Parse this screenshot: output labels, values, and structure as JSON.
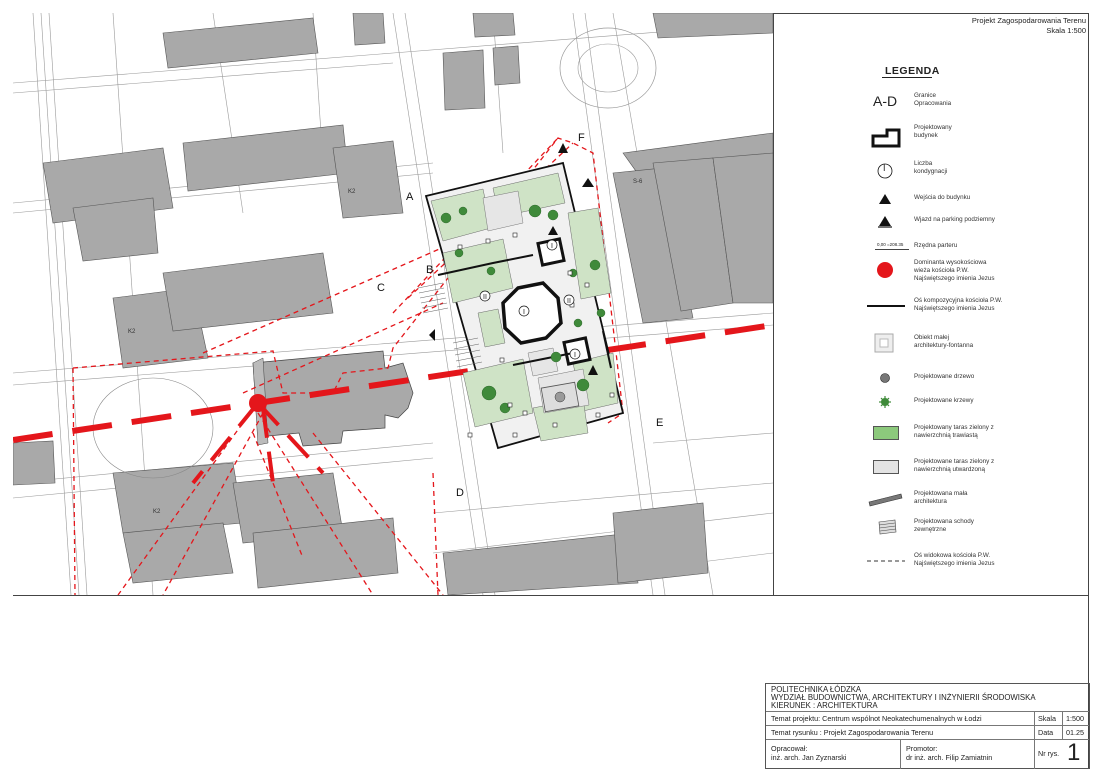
{
  "header": {
    "title": "Projekt Zagospodarowania Terenu",
    "scale": "Skala 1:500"
  },
  "legend": {
    "title": "LEGENDA",
    "items": [
      {
        "symbol": "A-D",
        "text": "Granice\nOpracowania"
      },
      {
        "text": "Projektowany\nbudynek"
      },
      {
        "symbol": "I",
        "text": "Liczba\nkondygnacji"
      },
      {
        "text": "Wejścia do budynku"
      },
      {
        "text": "Wjazd na parking podziemny"
      },
      {
        "symbol": "0,00 =208.35",
        "text": "Rzędna parteru"
      },
      {
        "text": "Dominanta wysokościowa\nwieża kościoła P.W.\nNajświętszego imienia Jezus"
      },
      {
        "text": "Oś kompozycyjna kościoła P.W.\nNajświętszego imienia Jezus"
      },
      {
        "text": "Obiekt małej\narchitektury-fontanna"
      },
      {
        "text": "Projektowane drzewo"
      },
      {
        "text": "Projektowane krzewy"
      },
      {
        "text": "Projektowany taras zielony z\nnawierzchnią trawiastą"
      },
      {
        "text": "Projektowane taras zielony z\nnawierzchnią utwardzoną"
      },
      {
        "text": "Projektowana mała\narchitektura"
      },
      {
        "text": "Projektowana schody\nzewnętrzne"
      },
      {
        "text": "Oś widokowa kościoła P.W.\nNajświętszego imienia Jezus"
      }
    ]
  },
  "map_labels": {
    "A": "A",
    "B": "B",
    "C": "C",
    "D": "D",
    "E": "E",
    "F": "F",
    "level_1a": "I",
    "level_1b": "I",
    "level_1c": "I",
    "level_2a": "II",
    "level_2b": "II",
    "s6": "S-6",
    "k2a": "K2",
    "k2b": "K2",
    "k2c": "K2"
  },
  "titleblock": {
    "university": "POLITECHNIKA ŁÓDZKA",
    "faculty": "WYDZIAŁ BUDOWNICTWA, ARCHITEKTURY I INŻYNIERII ŚRODOWISKA",
    "course": "KIERUNEK : ARCHITEKTURA",
    "project_topic": "Temat projektu: Centrum wspólnot Neokatechumenalnych w Łodzi",
    "scale_label": "Skala",
    "scale_value": "1:500",
    "drawing_topic": "Temat rysunku : Projekt Zagospodarowania Terenu",
    "date_label": "Data",
    "date_value": "01.25",
    "author_label": "Opracował:",
    "author": "inż. arch. Jan Zyznarski",
    "promoter_label": "Promotor:",
    "promoter": "dr inż. arch. Filip Zamiatnin",
    "sheet_label": "Nr rys.",
    "sheet_no": "1"
  },
  "colors": {
    "red": "#e4161b",
    "building_grey": "#a9a9a9",
    "grass": "#cfe3c6",
    "paving": "#e6e6e6",
    "linework": "#777777"
  }
}
